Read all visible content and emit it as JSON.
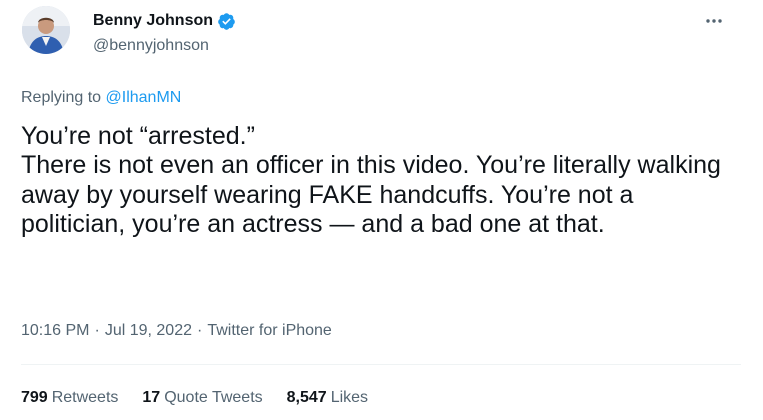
{
  "author": {
    "display_name": "Benny Johnson",
    "handle": "@bennyjohnson",
    "verified_icon": "verified-badge-icon"
  },
  "more_icon": "more-horizontal-icon",
  "reply": {
    "prefix": "Replying to ",
    "to": "@IlhanMN"
  },
  "tweet": {
    "lines": [
      "You’re not “arrested.”",
      "There is not even an officer in this video. You’re literally walking away by yourself wearing FAKE handcuffs. You’re not a politician, you’re an actress — and a bad one at that."
    ]
  },
  "meta": {
    "time": "10:16 PM",
    "separator1": "·",
    "date": "Jul 19, 2022",
    "separator2": "·",
    "source": "Twitter for iPhone"
  },
  "stats": {
    "retweets_count": "799",
    "retweets_label": "Retweets",
    "quotes_count": "17",
    "quotes_label": "Quote Tweets",
    "likes_count": "8,547",
    "likes_label": "Likes"
  },
  "colors": {
    "accent": "#1d9bf0",
    "secondary_text": "#536471",
    "primary_text": "#0f1419"
  }
}
